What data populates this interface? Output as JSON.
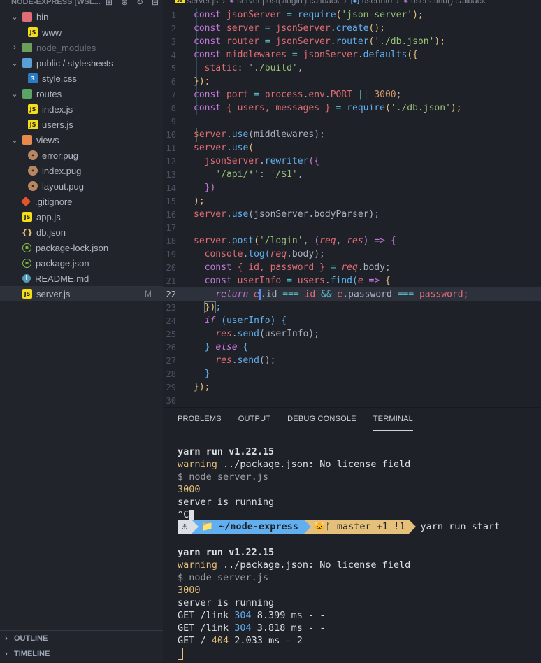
{
  "explorer": {
    "title": "NODE-EXPRESS [WSL...",
    "actions": [
      "new-file-icon",
      "new-folder-icon",
      "refresh-icon",
      "collapse-icon"
    ],
    "items": [
      {
        "label": "bin",
        "type": "folder",
        "expanded": true
      },
      {
        "label": "www",
        "type": "js"
      },
      {
        "label": "node_modules",
        "type": "folder",
        "expanded": false
      },
      {
        "label": "public / stylesheets",
        "type": "folder",
        "expanded": true
      },
      {
        "label": "style.css",
        "type": "css"
      },
      {
        "label": "routes",
        "type": "folder",
        "expanded": true
      },
      {
        "label": "index.js",
        "type": "js"
      },
      {
        "label": "users.js",
        "type": "js"
      },
      {
        "label": "views",
        "type": "folder",
        "expanded": true
      },
      {
        "label": "error.pug",
        "type": "pug"
      },
      {
        "label": "index.pug",
        "type": "pug"
      },
      {
        "label": "layout.pug",
        "type": "pug"
      },
      {
        "label": ".gitignore",
        "type": "git"
      },
      {
        "label": "app.js",
        "type": "js"
      },
      {
        "label": "db.json",
        "type": "json"
      },
      {
        "label": "package-lock.json",
        "type": "npm"
      },
      {
        "label": "package.json",
        "type": "npm"
      },
      {
        "label": "README.md",
        "type": "info"
      },
      {
        "label": "server.js",
        "type": "js",
        "badge": "M"
      }
    ],
    "outline_label": "OUTLINE",
    "timeline_label": "TIMELINE"
  },
  "breadcrumb": {
    "file": "server.js",
    "segments": [
      "server.post('/login') callback",
      "userInfo",
      "users.find() callback"
    ]
  },
  "editor": {
    "current_line": 22,
    "line_numbers": [
      "1",
      "2",
      "3",
      "4",
      "5",
      "6",
      "7",
      "8",
      "9",
      "10",
      "11",
      "12",
      "13",
      "14",
      "15",
      "16",
      "17",
      "18",
      "19",
      "20",
      "21",
      "22",
      "23",
      "24",
      "25",
      "26",
      "27",
      "28",
      "29",
      "30"
    ]
  },
  "code_text": {
    "l1": [
      "const",
      "jsonServer",
      "=",
      "require",
      "(",
      "'json-server'",
      ");"
    ],
    "l2": [
      "const",
      "server",
      "=",
      "jsonServer",
      ".",
      "create",
      "();"
    ],
    "l3": [
      "const",
      "router",
      "=",
      "jsonServer",
      ".",
      "router",
      "(",
      "'./db.json'",
      ");"
    ],
    "l4": [
      "const",
      "middlewares",
      "=",
      "jsonServer",
      ".",
      "defaults",
      "({"
    ],
    "l5": [
      "static",
      ":",
      "'./build'",
      ","
    ],
    "l6": [
      "});"
    ],
    "l7": [
      "const",
      "port",
      "=",
      "process",
      ".",
      "env",
      ".",
      "PORT",
      "||",
      "3000",
      ";"
    ],
    "l8": [
      "const",
      "{ users, messages }",
      "=",
      "require",
      "(",
      "'./db.json'",
      ");"
    ],
    "l10": [
      "server",
      ".",
      "use",
      "(middlewares);"
    ],
    "l11": [
      "server",
      ".",
      "use",
      "("
    ],
    "l12": [
      "jsonServer",
      ".",
      "rewriter",
      "({"
    ],
    "l13": [
      "'/api/*'",
      ":",
      "'/$1'",
      ","
    ],
    "l14": [
      "})"
    ],
    "l15": [
      ");"
    ],
    "l16": [
      "server",
      ".",
      "use",
      "(jsonServer.bodyParser);"
    ],
    "l18": [
      "server",
      ".",
      "post",
      "(",
      "'/login'",
      ",",
      "(",
      "req",
      ",",
      "res",
      ")",
      "=>",
      "{"
    ],
    "l19": [
      "console",
      ".",
      "log",
      "(",
      "req",
      ".body);"
    ],
    "l20": [
      "const",
      "{ id, password }",
      "=",
      "req",
      ".body;"
    ],
    "l21": [
      "const",
      "userInfo",
      "=",
      "users",
      ".",
      "find",
      "(",
      "e",
      "=>",
      "{"
    ],
    "l22": [
      "return",
      "e",
      ".id",
      "===",
      "id",
      "&&",
      "e",
      ".password",
      "===",
      "password;"
    ],
    "l23": [
      "})",
      ";"
    ],
    "l24": [
      "if",
      "(userInfo)",
      "{"
    ],
    "l25": [
      "res",
      ".",
      "send",
      "(userInfo);"
    ],
    "l26": [
      "}",
      "else",
      "{"
    ],
    "l27": [
      "res",
      ".",
      "send",
      "();"
    ],
    "l28": [
      "}"
    ],
    "l29": [
      "});"
    ]
  },
  "panel": {
    "tabs": [
      "PROBLEMS",
      "OUTPUT",
      "DEBUG CONSOLE",
      "TERMINAL"
    ],
    "active_tab": "TERMINAL"
  },
  "terminal": {
    "block1": {
      "yarn": "yarn run v1.22.15",
      "warning_word": "warning",
      "warning_rest": " ../package.json: No license field",
      "cmd": "$ node server.js",
      "port": "3000",
      "running": "server is running",
      "ctrl_c": "^C"
    },
    "prompt": {
      "seg1": "⚓",
      "seg2": "📁 ~/node-express",
      "seg3": "🐱ᚴ master +1 !1",
      "command": "yarn run start"
    },
    "block2": {
      "yarn": "yarn run v1.22.15",
      "warning_word": "warning",
      "warning_rest": " ../package.json: No license field",
      "cmd": "$ node server.js",
      "port": "3000",
      "running": "server is running"
    },
    "requests": [
      {
        "method_path": "GET /link ",
        "status": "304",
        "rest": " 8.399 ms - -"
      },
      {
        "method_path": "GET /link ",
        "status": "304",
        "rest": " 3.818 ms - -"
      },
      {
        "method_path": "GET / ",
        "status": "404",
        "rest": " 2.033 ms - 2"
      }
    ]
  },
  "colors": {
    "background": "#1e2127",
    "sidebar": "#21252b",
    "keyword": "#c678dd",
    "string": "#98c379",
    "function": "#61afef",
    "number": "#d19a66",
    "variable": "#e06c75"
  }
}
